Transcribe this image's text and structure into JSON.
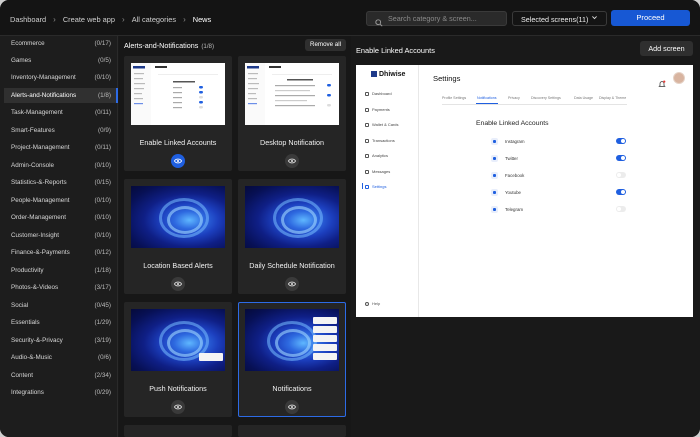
{
  "breadcrumb": [
    "Dashboard",
    "Create web app",
    "All categories",
    "News"
  ],
  "search": {
    "placeholder": "Search category & screen..."
  },
  "selected_screens_label": "Selected screens(11)",
  "proceed_label": "Proceed",
  "sidebar": {
    "items": [
      {
        "label": "Ecommerce",
        "count": "(0/17)"
      },
      {
        "label": "Games",
        "count": "(0/5)"
      },
      {
        "label": "Inventory-Management",
        "count": "(0/10)"
      },
      {
        "label": "Alerts-and-Notifications",
        "count": "(1/8)",
        "active": true
      },
      {
        "label": "Task-Management",
        "count": "(0/11)"
      },
      {
        "label": "Smart-Features",
        "count": "(0/9)"
      },
      {
        "label": "Project-Management",
        "count": "(0/11)"
      },
      {
        "label": "Admin-Console",
        "count": "(0/10)"
      },
      {
        "label": "Statistics-&-Reports",
        "count": "(0/15)"
      },
      {
        "label": "People-Management",
        "count": "(0/10)"
      },
      {
        "label": "Order-Management",
        "count": "(0/10)"
      },
      {
        "label": "Customer-Insight",
        "count": "(0/10)"
      },
      {
        "label": "Finance-&-Payments",
        "count": "(0/12)"
      },
      {
        "label": "Productivity",
        "count": "(1/18)"
      },
      {
        "label": "Photos-&-Videos",
        "count": "(3/17)"
      },
      {
        "label": "Social",
        "count": "(0/45)"
      },
      {
        "label": "Essentials",
        "count": "(1/29)"
      },
      {
        "label": "Security-&-Privacy",
        "count": "(3/19)"
      },
      {
        "label": "Audio-&-Music",
        "count": "(0/6)"
      },
      {
        "label": "Content",
        "count": "(2/34)"
      },
      {
        "label": "Integrations",
        "count": "(0/29)"
      }
    ]
  },
  "middle": {
    "title": "Alerts-and-Notifications",
    "count": "(1/8)",
    "remove_all_label": "Remove all",
    "cards": [
      {
        "label": "Enable Linked Accounts",
        "thumb": "settings",
        "viewed": true
      },
      {
        "label": "Desktop Notification",
        "thumb": "settings"
      },
      {
        "label": "Location Based Alerts",
        "thumb": "wallpaper"
      },
      {
        "label": "Daily Schedule Notification",
        "thumb": "wallpaper"
      },
      {
        "label": "Push Notifications",
        "thumb": "wallpaper-notif"
      },
      {
        "label": "Notifications",
        "thumb": "wallpaper-notif",
        "selected": true
      }
    ]
  },
  "preview": {
    "title": "Enable Linked Accounts",
    "add_screen_label": "Add screen",
    "logo": "Dhiwise",
    "nav": [
      "Dashboard",
      "Payments",
      "Wallet & Cards",
      "Transactions",
      "Analytics",
      "Messages",
      "Settings"
    ],
    "active_nav": "Settings",
    "help": "Help",
    "page_title": "Settings",
    "tabs": [
      "Profile Settings",
      "Notifications",
      "Privacy",
      "Discovery Settings",
      "Data Usage",
      "Display & Theme"
    ],
    "active_tab": "Notifications",
    "section_title": "Enable Linked Accounts",
    "accounts": [
      {
        "name": "Instagram",
        "enabled": true
      },
      {
        "name": "Twitter",
        "enabled": true
      },
      {
        "name": "Facebook",
        "enabled": false
      },
      {
        "name": "Youtube",
        "enabled": true
      },
      {
        "name": "Telegram",
        "enabled": false
      }
    ]
  },
  "colors": {
    "accent": "#1758d4",
    "background": "#191919",
    "sidebar": "#1d1d1d"
  }
}
